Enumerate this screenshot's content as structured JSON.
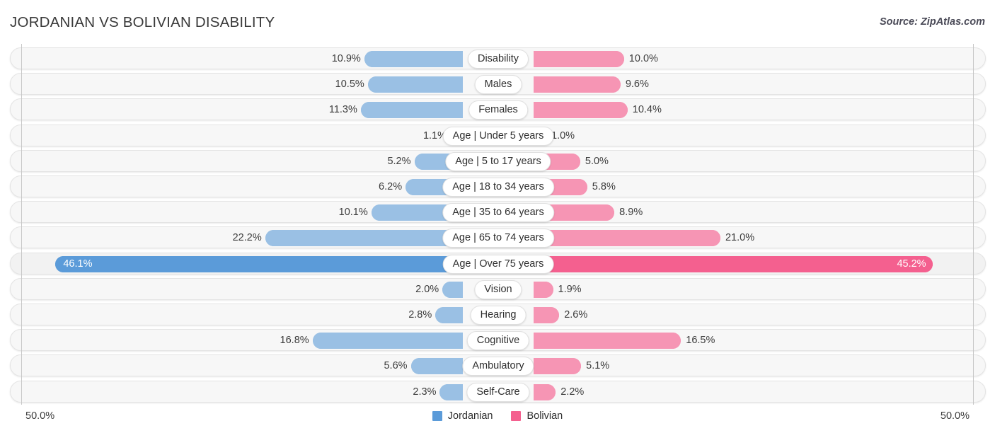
{
  "header": {
    "title": "JORDANIAN VS BOLIVIAN DISABILITY",
    "source": "Source: ZipAtlas.com"
  },
  "footer": {
    "axis_left": "50.0%",
    "axis_right": "50.0%"
  },
  "legend": [
    {
      "label": "Jordanian",
      "color": "#5b9bd9"
    },
    {
      "label": "Bolivian",
      "color": "#f4608f"
    }
  ],
  "colors": {
    "left_bar": "#9ac0e4",
    "right_bar": "#f695b4",
    "left_bar_highlight": "#5b9bd9",
    "right_bar_highlight": "#f4608f",
    "row_track": "#f7f7f7",
    "gridline": "#c8c8c8"
  },
  "chart_data": {
    "type": "bar",
    "title": "JORDANIAN VS BOLIVIAN DISABILITY",
    "subtitle": "Source: ZipAtlas.com",
    "orientation": "horizontal-diverging",
    "xlabel": "",
    "ylabel": "",
    "axis_max_percent": 50.0,
    "axis_tick_labels": [
      "50.0%",
      "50.0%"
    ],
    "grid": true,
    "legend_position": "bottom-center",
    "categories": [
      "Disability",
      "Males",
      "Females",
      "Age | Under 5 years",
      "Age | 5 to 17 years",
      "Age | 18 to 34 years",
      "Age | 35 to 64 years",
      "Age | 65 to 74 years",
      "Age | Over 75 years",
      "Vision",
      "Hearing",
      "Cognitive",
      "Ambulatory",
      "Self-Care"
    ],
    "series": [
      {
        "name": "Jordanian",
        "color": "#5b9bd9",
        "values": [
          10.9,
          10.5,
          11.3,
          1.1,
          5.2,
          6.2,
          10.1,
          22.2,
          46.1,
          2.0,
          2.8,
          16.8,
          5.6,
          2.3
        ],
        "labels": [
          "10.9%",
          "10.5%",
          "11.3%",
          "1.1%",
          "5.2%",
          "6.2%",
          "10.1%",
          "22.2%",
          "46.1%",
          "2.0%",
          "2.8%",
          "16.8%",
          "5.6%",
          "2.3%"
        ]
      },
      {
        "name": "Bolivian",
        "color": "#f4608f",
        "values": [
          10.0,
          9.6,
          10.4,
          1.0,
          5.0,
          5.8,
          8.9,
          21.0,
          45.2,
          1.9,
          2.6,
          16.5,
          5.1,
          2.2
        ],
        "labels": [
          "10.0%",
          "9.6%",
          "10.4%",
          "1.0%",
          "5.0%",
          "5.8%",
          "8.9%",
          "21.0%",
          "45.2%",
          "1.9%",
          "2.6%",
          "16.5%",
          "5.1%",
          "2.2%"
        ]
      }
    ],
    "highlighted_category": "Age | Over 75 years"
  },
  "rows": [
    {
      "label": "Disability",
      "left_value": "10.9%",
      "right_value": "10.0%",
      "highlight": false
    },
    {
      "label": "Males",
      "left_value": "10.5%",
      "right_value": "9.6%",
      "highlight": false
    },
    {
      "label": "Females",
      "left_value": "11.3%",
      "right_value": "10.4%",
      "highlight": false
    },
    {
      "label": "Age | Under 5 years",
      "left_value": "1.1%",
      "right_value": "1.0%",
      "highlight": false
    },
    {
      "label": "Age | 5 to 17 years",
      "left_value": "5.2%",
      "right_value": "5.0%",
      "highlight": false
    },
    {
      "label": "Age | 18 to 34 years",
      "left_value": "6.2%",
      "right_value": "5.8%",
      "highlight": false
    },
    {
      "label": "Age | 35 to 64 years",
      "left_value": "10.1%",
      "right_value": "8.9%",
      "highlight": false
    },
    {
      "label": "Age | 65 to 74 years",
      "left_value": "22.2%",
      "right_value": "21.0%",
      "highlight": false
    },
    {
      "label": "Age | Over 75 years",
      "left_value": "46.1%",
      "right_value": "45.2%",
      "highlight": true
    },
    {
      "label": "Vision",
      "left_value": "2.0%",
      "right_value": "1.9%",
      "highlight": false
    },
    {
      "label": "Hearing",
      "left_value": "2.8%",
      "right_value": "2.6%",
      "highlight": false
    },
    {
      "label": "Cognitive",
      "left_value": "16.8%",
      "right_value": "16.5%",
      "highlight": false
    },
    {
      "label": "Ambulatory",
      "left_value": "5.6%",
      "right_value": "5.1%",
      "highlight": false
    },
    {
      "label": "Self-Care",
      "left_value": "2.3%",
      "right_value": "2.2%",
      "highlight": false
    }
  ]
}
